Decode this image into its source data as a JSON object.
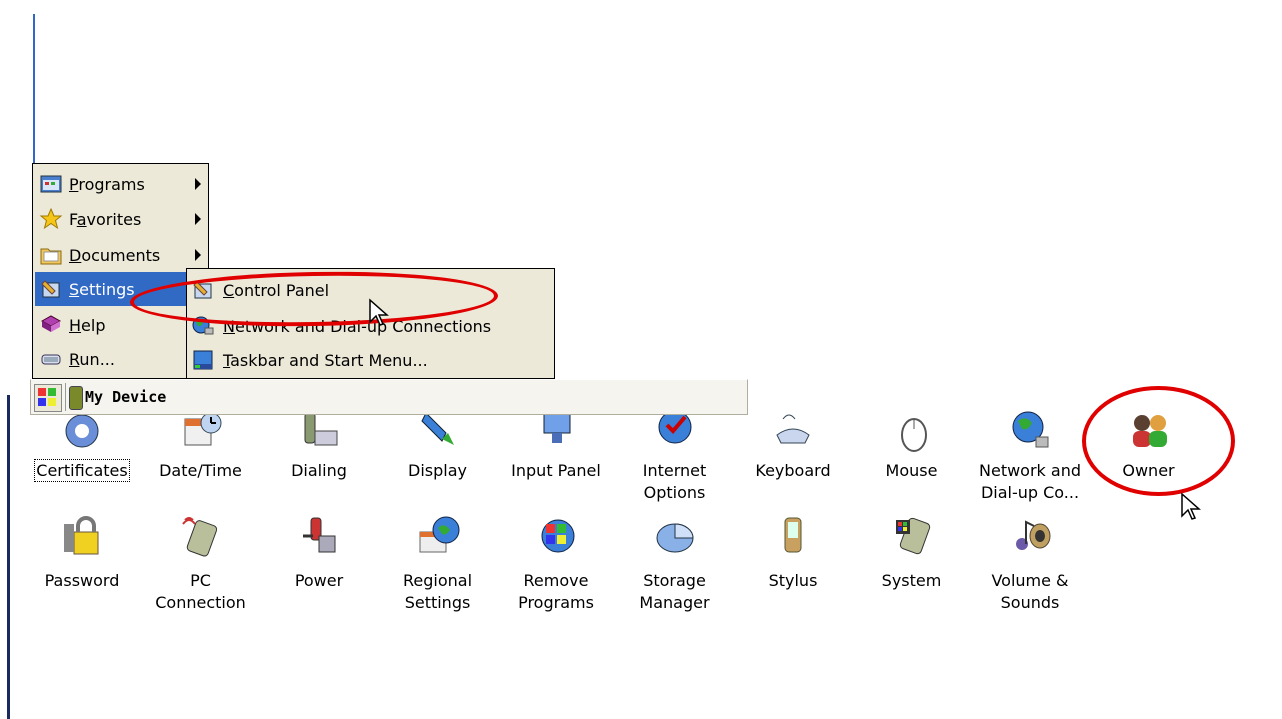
{
  "start_menu": {
    "items": [
      {
        "label": "Programs",
        "accel": "P",
        "rest": "rograms",
        "icon": "programs-icon",
        "has_submenu": true
      },
      {
        "label": "Favorites",
        "accel_pre": "F",
        "accel": "a",
        "rest": "vorites",
        "icon": "favorites-star-icon",
        "has_submenu": true
      },
      {
        "label": "Documents",
        "accel": "D",
        "rest": "ocuments",
        "icon": "documents-folder-icon",
        "has_submenu": true
      },
      {
        "label": "Settings",
        "accel": "S",
        "rest": "ettings",
        "icon": "settings-icon",
        "has_submenu": true,
        "selected": true
      },
      {
        "label": "Help",
        "accel": "H",
        "rest": "elp",
        "icon": "help-book-icon"
      },
      {
        "label": "Run...",
        "accel": "R",
        "rest": "un...",
        "icon": "run-icon"
      }
    ]
  },
  "settings_submenu": {
    "items": [
      {
        "label": "Control Panel",
        "accel": "C",
        "rest": "ontrol Panel",
        "icon": "control-panel-icon"
      },
      {
        "label": "Network and Dial-up Connections",
        "accel": "N",
        "rest": "etwork and Dial-up Connections",
        "icon": "network-globe-icon"
      },
      {
        "label": "Taskbar and Start Menu...",
        "accel": "T",
        "rest": "askbar and Start Menu...",
        "icon": "taskbar-icon"
      }
    ]
  },
  "taskbar": {
    "device_label": "My Device"
  },
  "control_panel": {
    "row1": [
      {
        "line1": "Certificates",
        "line2": "",
        "icon": "certificates-icon"
      },
      {
        "line1": "Date/Time",
        "line2": "",
        "icon": "date-time-icon"
      },
      {
        "line1": "Dialing",
        "line2": "",
        "icon": "dialing-icon"
      },
      {
        "line1": "Display",
        "line2": "",
        "icon": "display-icon"
      },
      {
        "line1": "Input Panel",
        "line2": "",
        "icon": "input-panel-icon"
      },
      {
        "line1": "Internet",
        "line2": "Options",
        "icon": "internet-options-icon"
      },
      {
        "line1": "Keyboard",
        "line2": "",
        "icon": "keyboard-icon"
      },
      {
        "line1": "Mouse",
        "line2": "",
        "icon": "mouse-icon"
      },
      {
        "line1": "Network and",
        "line2": "Dial-up Co...",
        "icon": "network-icon"
      },
      {
        "line1": "Owner",
        "line2": "",
        "icon": "owner-icon"
      }
    ],
    "row2": [
      {
        "line1": "Password",
        "line2": "",
        "icon": "password-lock-icon"
      },
      {
        "line1": "PC",
        "line2": "Connection",
        "icon": "pc-connection-icon"
      },
      {
        "line1": "Power",
        "line2": "",
        "icon": "power-icon"
      },
      {
        "line1": "Regional",
        "line2": "Settings",
        "icon": "regional-settings-icon"
      },
      {
        "line1": "Remove",
        "line2": "Programs",
        "icon": "remove-programs-icon"
      },
      {
        "line1": "Storage",
        "line2": "Manager",
        "icon": "storage-manager-icon"
      },
      {
        "line1": "Stylus",
        "line2": "",
        "icon": "stylus-icon"
      },
      {
        "line1": "System",
        "line2": "",
        "icon": "system-icon"
      },
      {
        "line1": "Volume &",
        "line2": "Sounds",
        "icon": "volume-sounds-icon"
      }
    ]
  },
  "colors": {
    "menu_bg": "#ece9d8",
    "selection": "#316ac5",
    "annotation": "#e00000"
  }
}
